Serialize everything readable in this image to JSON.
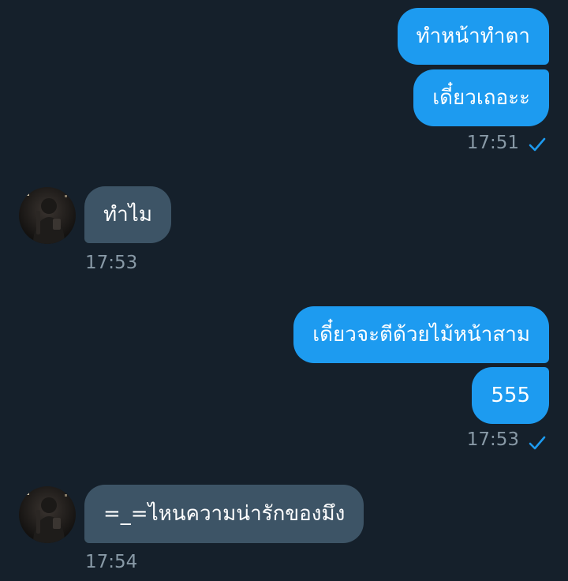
{
  "colors": {
    "background": "#15202b",
    "outgoing_bubble": "#1d9bf0",
    "incoming_bubble": "#3d5466",
    "timestamp": "#8899a6",
    "read_check": "#1d9bf0"
  },
  "conversation": {
    "group1": {
      "messages": [
        "ทำหน้าทำตา",
        "เดี๋ยวเถอะะ"
      ],
      "time": "17:51",
      "status_icon": "check-icon"
    },
    "group2": {
      "messages": [
        "ทำไม"
      ],
      "time": "17:53",
      "avatar_icon": "user-avatar"
    },
    "group3": {
      "messages": [
        "เดี๋ยวจะตีด้วยไม้หน้าสาม",
        "555"
      ],
      "time": "17:53",
      "status_icon": "check-icon"
    },
    "group4": {
      "messages": [
        "=_=ไหนความน่ารักของมึง"
      ],
      "time": "17:54",
      "avatar_icon": "user-avatar"
    }
  }
}
